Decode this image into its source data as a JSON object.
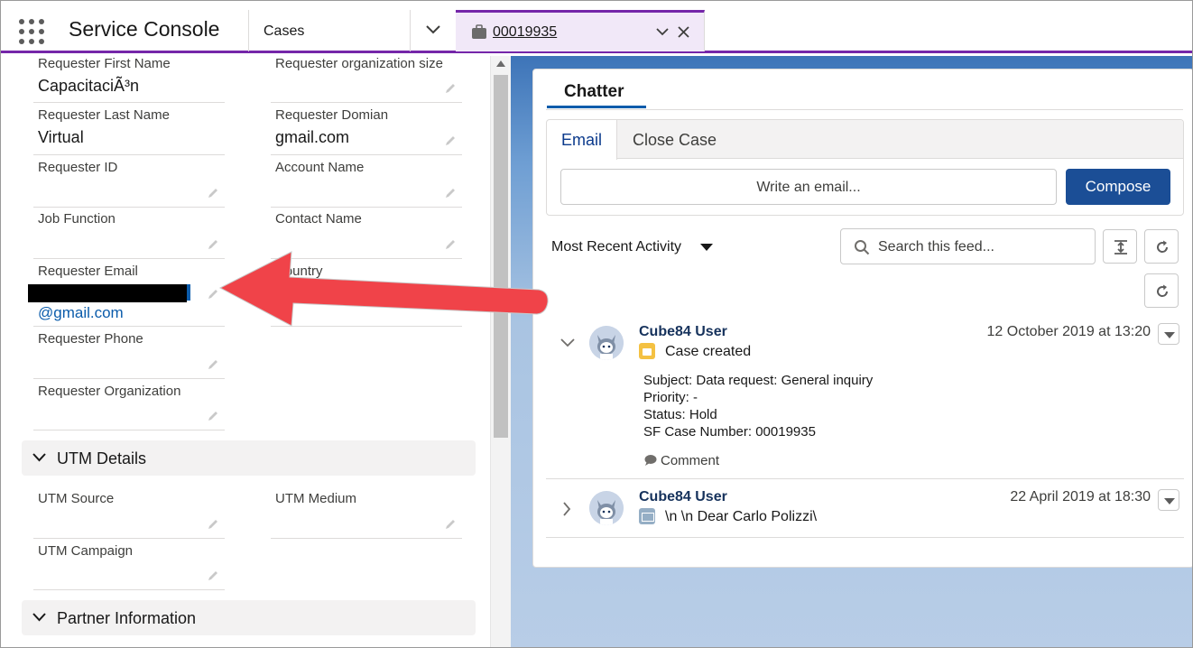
{
  "app": {
    "title": "Service Console"
  },
  "nav": {
    "object_label": "Cases"
  },
  "tab": {
    "case_number": "00019935"
  },
  "record": {
    "fields_left": [
      {
        "label": "Requester First Name",
        "value": "CapacitaciÃ³n"
      },
      {
        "label": "Requester Last Name",
        "value": "Virtual"
      },
      {
        "label": "Requester ID",
        "value": ""
      },
      {
        "label": "Job Function",
        "value": ""
      },
      {
        "label": "Requester Email",
        "value": "@gmail.com"
      },
      {
        "label": "Requester Phone",
        "value": ""
      },
      {
        "label": "Requester Organization",
        "value": ""
      }
    ],
    "fields_right": [
      {
        "label": "Requester organization size",
        "value": ""
      },
      {
        "label": "Requester Domian",
        "value": "gmail.com"
      },
      {
        "label": "Account Name",
        "value": ""
      },
      {
        "label": "Contact Name",
        "value": ""
      },
      {
        "label": "Country",
        "value": ""
      }
    ],
    "utm_section": {
      "title": "UTM Details",
      "fields": [
        {
          "label": "UTM Source"
        },
        {
          "label": "UTM Medium"
        },
        {
          "label": "UTM Campaign"
        }
      ]
    },
    "partner_section": {
      "title": "Partner Information"
    }
  },
  "chatter": {
    "tab_label": "Chatter",
    "publisher": {
      "tabs": [
        "Email",
        "Close Case"
      ],
      "input_placeholder": "Write an email...",
      "compose_label": "Compose"
    },
    "sort_label": "Most Recent Activity",
    "search_placeholder": "Search this feed...",
    "feed": [
      {
        "author": "Cube84 User",
        "date": "12 October 2019 at 13:20",
        "title": "Case created",
        "details": [
          "Subject: Data request: General inquiry",
          "Priority: -",
          "Status: Hold",
          "SF Case Number: 00019935"
        ],
        "comment_label": "Comment"
      },
      {
        "author": "Cube84 User",
        "date": "22 April 2019 at 18:30",
        "title": "\\n \\n Dear Carlo Polizzi\\"
      }
    ]
  },
  "colors": {
    "brand_purple": "#7526a9",
    "primary_blue": "#1b4e96",
    "annotation_arrow": "#f04349"
  }
}
